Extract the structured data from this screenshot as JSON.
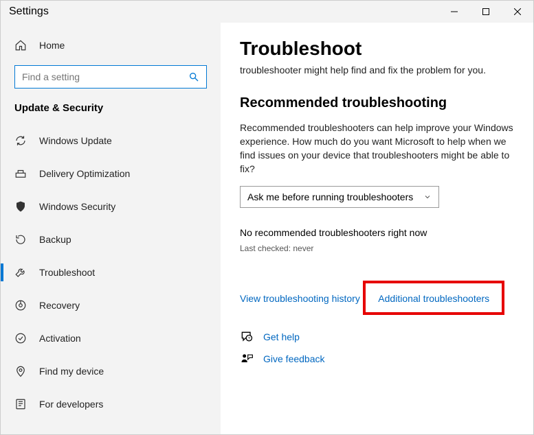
{
  "window": {
    "title": "Settings"
  },
  "sidebar": {
    "home": "Home",
    "search_placeholder": "Find a setting",
    "category": "Update & Security",
    "items": [
      {
        "label": "Windows Update",
        "icon": "sync"
      },
      {
        "label": "Delivery Optimization",
        "icon": "delivery"
      },
      {
        "label": "Windows Security",
        "icon": "shield"
      },
      {
        "label": "Backup",
        "icon": "backup"
      },
      {
        "label": "Troubleshoot",
        "icon": "wrench",
        "active": true
      },
      {
        "label": "Recovery",
        "icon": "recovery"
      },
      {
        "label": "Activation",
        "icon": "activation"
      },
      {
        "label": "Find my device",
        "icon": "location"
      },
      {
        "label": "For developers",
        "icon": "developer"
      }
    ]
  },
  "content": {
    "title": "Troubleshoot",
    "lead": "troubleshooter might help find and fix the problem for you.",
    "section_heading": "Recommended troubleshooting",
    "section_body": "Recommended troubleshooters can help improve your Windows experience. How much do you want Microsoft to help when we find issues on your device that troubleshooters might be able to fix?",
    "dropdown_value": "Ask me before running troubleshooters",
    "status": "No recommended troubleshooters right now",
    "last_checked": "Last checked: never",
    "history_link": "View troubleshooting history",
    "additional_link": "Additional troubleshooters",
    "footer": {
      "help": "Get help",
      "feedback": "Give feedback"
    }
  }
}
